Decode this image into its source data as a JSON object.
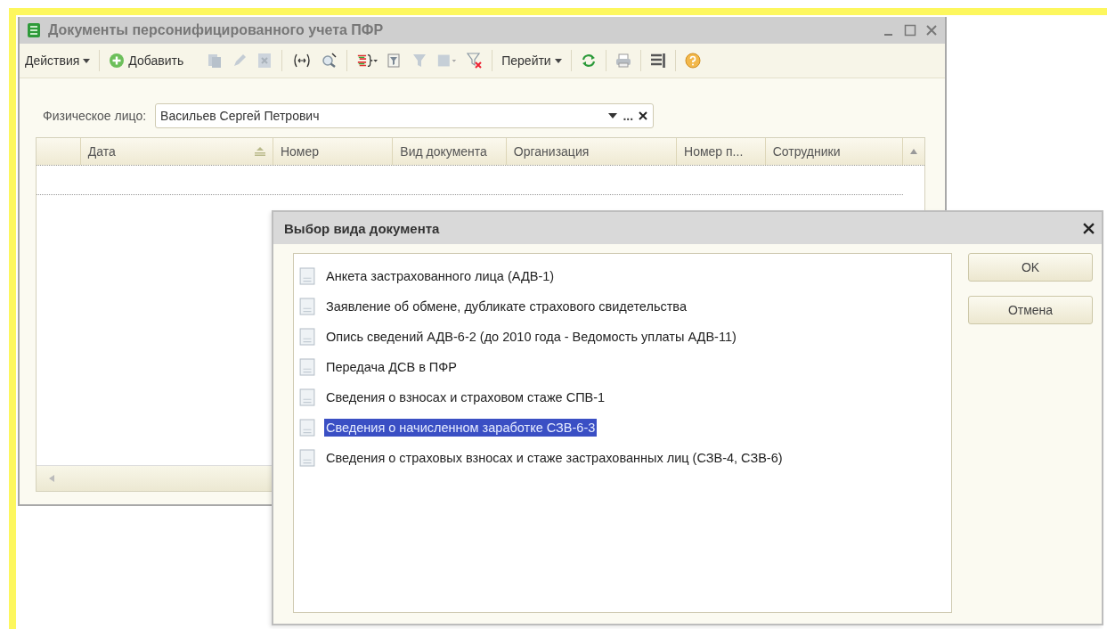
{
  "main_window": {
    "title": "Документы персонифицированного учета ПФР",
    "toolbar": {
      "actions_menu": "Действия",
      "add_button": "Добавить",
      "go_menu": "Перейти"
    },
    "filter": {
      "label": "Физическое лицо:",
      "value": "Васильев Сергей Петрович",
      "select_button": "..."
    },
    "table": {
      "columns": [
        {
          "label": "Дата",
          "sorted": true
        },
        {
          "label": "Номер",
          "sorted": false
        },
        {
          "label": "Вид документа",
          "sorted": false
        },
        {
          "label": "Организация",
          "sorted": false
        },
        {
          "label": "Номер п...",
          "sorted": false
        },
        {
          "label": "Сотрудники",
          "sorted": false
        }
      ]
    }
  },
  "dialog": {
    "title": "Выбор вида документа",
    "items": [
      {
        "label": "Анкета застрахованного лица (АДВ-1)",
        "selected": false
      },
      {
        "label": "Заявление об обмене, дубликате страхового свидетельства",
        "selected": false
      },
      {
        "label": "Опись сведений АДВ-6-2 (до 2010 года - Ведомость уплаты АДВ-11)",
        "selected": false
      },
      {
        "label": "Передача ДСВ в ПФР",
        "selected": false
      },
      {
        "label": "Сведения о взносах и страховом стаже СПВ-1",
        "selected": false
      },
      {
        "label": "Сведения о начисленном заработке СЗВ-6-3",
        "selected": true
      },
      {
        "label": "Сведения о страховых взносах и стаже застрахованных лиц (СЗВ-4, СЗВ-6)",
        "selected": false
      }
    ],
    "buttons": [
      "OK",
      "Отмена"
    ]
  }
}
